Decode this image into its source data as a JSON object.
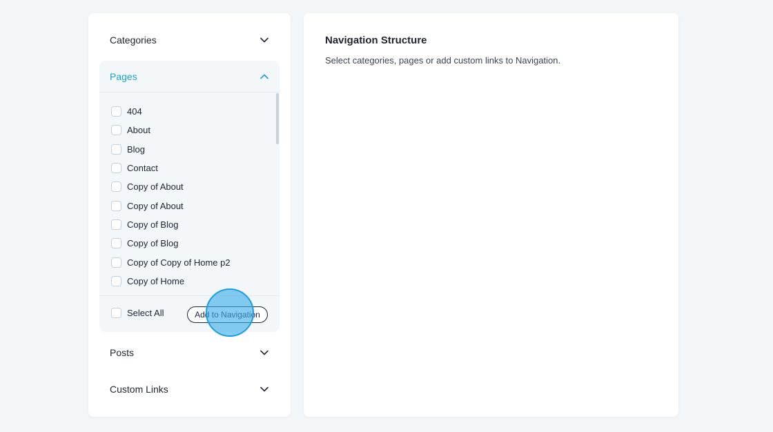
{
  "sidebar": {
    "categories": {
      "label": "Categories",
      "icon": "chevron-down-icon"
    },
    "pages": {
      "label": "Pages",
      "icon": "chevron-up-icon",
      "items": [
        {
          "label": "404"
        },
        {
          "label": "About"
        },
        {
          "label": "Blog"
        },
        {
          "label": "Contact"
        },
        {
          "label": "Copy of About"
        },
        {
          "label": "Copy of About"
        },
        {
          "label": "Copy of Blog"
        },
        {
          "label": "Copy of Blog"
        },
        {
          "label": "Copy of Copy of Home p2"
        },
        {
          "label": "Copy of Home"
        }
      ],
      "select_all_label": "Select All",
      "add_button_label": "Add to Navigation"
    },
    "posts": {
      "label": "Posts",
      "icon": "chevron-down-icon"
    },
    "custom_links": {
      "label": "Custom Links",
      "icon": "chevron-down-icon"
    }
  },
  "main": {
    "title": "Navigation Structure",
    "description": "Select categories, pages or add custom links to Navigation."
  },
  "colors": {
    "accent": "#1b9fcf",
    "background": "#f3f6f9",
    "panel": "#ffffff",
    "click_indicator": "#38ace8"
  }
}
